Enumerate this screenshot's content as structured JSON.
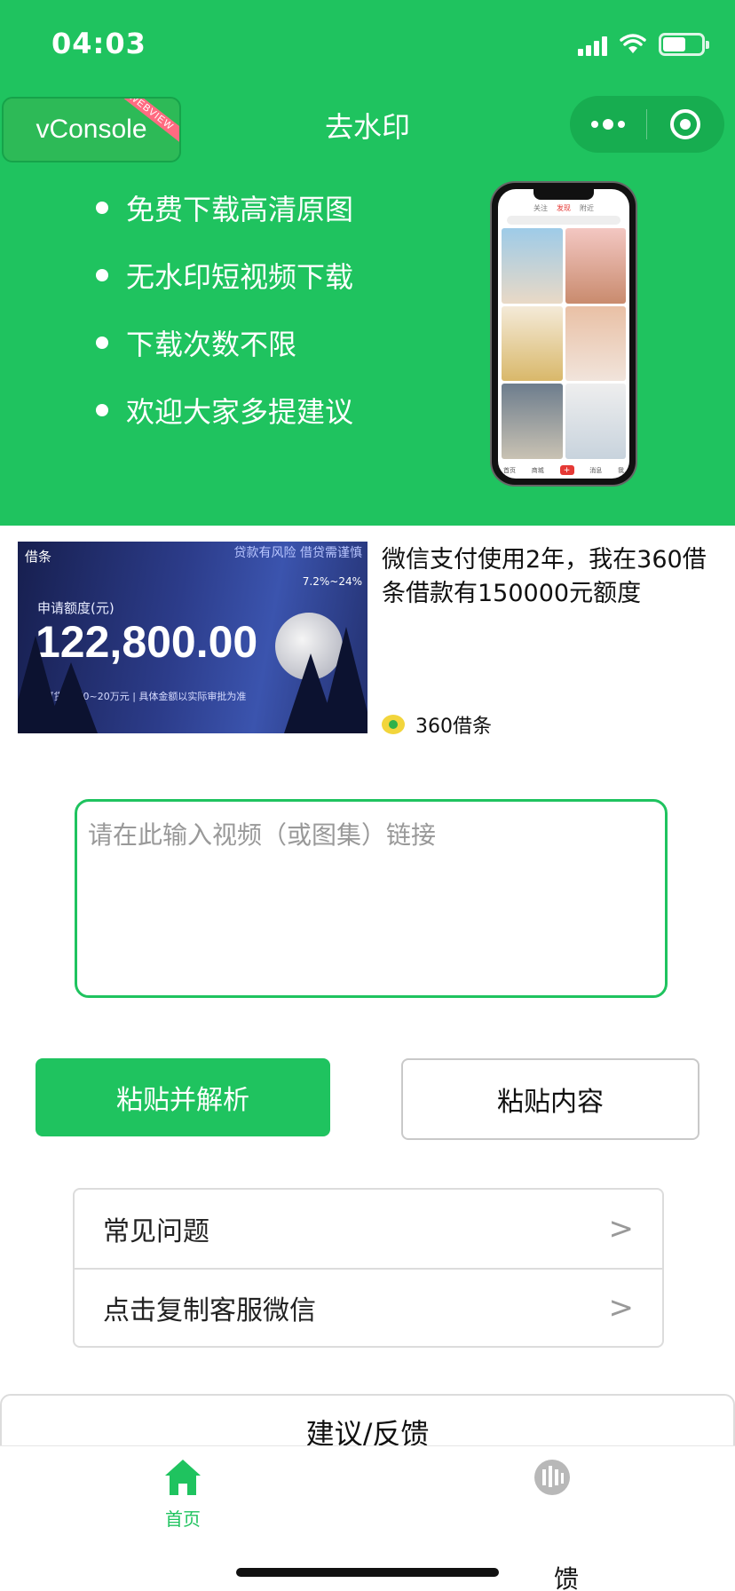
{
  "status_bar": {
    "time": "04:03",
    "battery_level": 0.6
  },
  "vconsole": {
    "label": "vConsole",
    "ribbon": "WEBVIEW"
  },
  "title": "去水印",
  "features": [
    "免费下载高清原图",
    "无水印短视频下载",
    "下载次数不限",
    "欢迎大家多提建议"
  ],
  "phone_mock": {
    "tabs": [
      "关注",
      "发现",
      "附近"
    ],
    "active_tab": "发现",
    "nav": [
      "首页",
      "商城",
      "+",
      "消息",
      "我"
    ]
  },
  "ad": {
    "image": {
      "logo": "借条",
      "risk": "贷款有风险 借贷需谨慎",
      "rate": "7.2%~24%",
      "amount_label": "申请额度(元)",
      "amount": "122,800.00",
      "note": "*可贷金额0~20万元 | 具体金额以实际审批为准"
    },
    "title": "微信支付使用2年，我在360借条借款有150000元额度",
    "brand": "360借条"
  },
  "link_input": {
    "placeholder": "请在此输入视频（或图集）链接",
    "value": ""
  },
  "buttons": {
    "parse": "粘贴并解析",
    "paste": "粘贴内容"
  },
  "menu": [
    {
      "label": "常见问题",
      "arrow": ">"
    },
    {
      "label": "点击复制客服微信",
      "arrow": ">"
    }
  ],
  "feedback": "建议/反馈",
  "tabbar": {
    "home": "首页",
    "overlay_label": "馈"
  },
  "colors": {
    "brand": "#1fc35f",
    "dark_brand": "#17ad50"
  }
}
